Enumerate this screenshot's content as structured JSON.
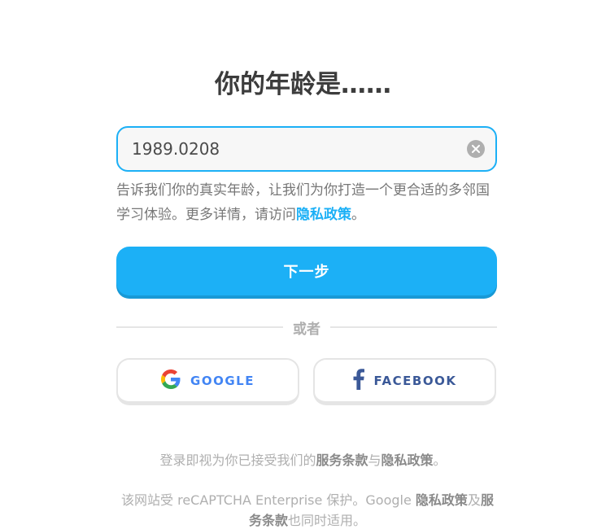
{
  "title": "你的年龄是……",
  "age_input": {
    "value": "1989.0208",
    "clear_icon": "clear-circle-icon"
  },
  "help": {
    "text": "告诉我们你的真实年龄，让我们为你打造一个更合适的多邻国学习体验。更多详情，请访问",
    "link": "隐私政策",
    "suffix": "。"
  },
  "next_button": "下一步",
  "divider_text": "或者",
  "social": {
    "google": {
      "label": "GOOGLE",
      "icon": "google-logo-icon",
      "color": "#4285f4"
    },
    "facebook": {
      "label": "FACEBOOK",
      "icon": "facebook-logo-icon",
      "color": "#3b5998"
    }
  },
  "terms": {
    "prefix": "登录即视为你已接受我们的",
    "terms_link": "服务条款",
    "middle": "与",
    "privacy_link": "隐私政策",
    "suffix": "。"
  },
  "recaptcha": {
    "prefix": "该网站受 reCAPTCHA Enterprise 保护。Google ",
    "privacy_link": "隐私政策",
    "middle": "及",
    "terms_link": "服务条款",
    "suffix": "也同时适用。"
  },
  "colors": {
    "accent": "#1cb0f6",
    "accent_shadow": "#1899d6",
    "text_dark": "#3c3c3c",
    "text_muted": "#777777",
    "text_light": "#afafaf"
  }
}
